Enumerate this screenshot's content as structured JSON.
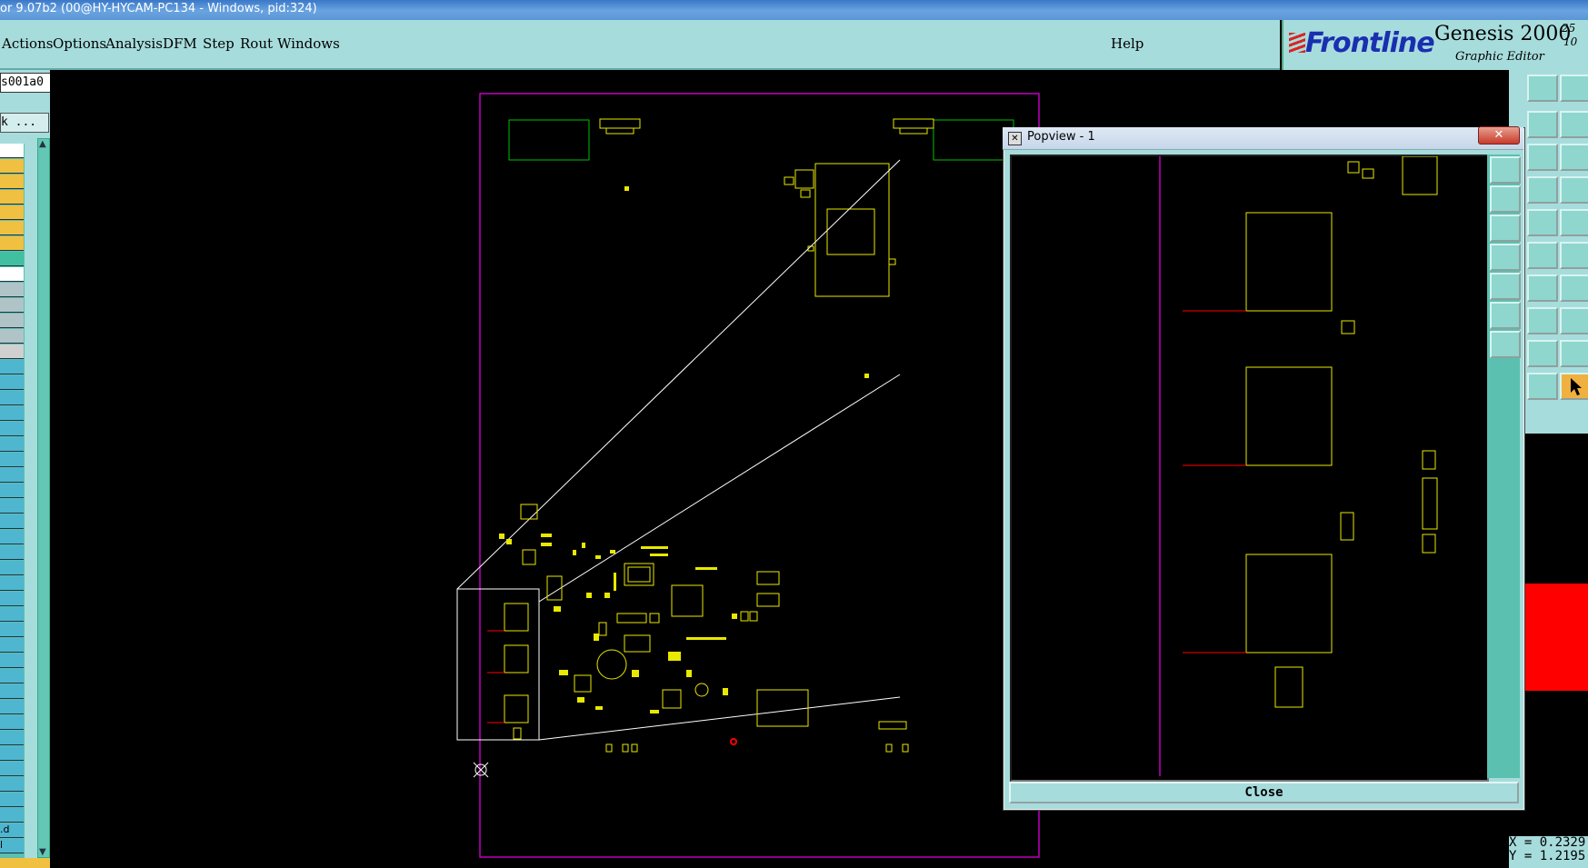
{
  "window_title": "or 9.07b2 (00@HY-HYCAM-PC134 - Windows, pid:324)",
  "menu": {
    "items": [
      "Actions",
      "Options",
      "Analysis",
      "DFM",
      "Step",
      "Rout",
      "Windows"
    ],
    "help": "Help"
  },
  "logo": {
    "brand": "Frontline",
    "product": "Genesis 2000",
    "version_top": "25",
    "version_bottom": "10",
    "subtitle": "Graphic Editor"
  },
  "left_panel": {
    "job_name": "s001a0",
    "filter_label": "k ...",
    "layer_row_labels": [
      "",
      "",
      "",
      "",
      "",
      "",
      "",
      "",
      "",
      "",
      "",
      "",
      "",
      "",
      "",
      "",
      "",
      "",
      "",
      "",
      "",
      "",
      "",
      "",
      "",
      "",
      "",
      "",
      "",
      "",
      "",
      "",
      "",
      "",
      "",
      "",
      "",
      "",
      "",
      "",
      "",
      "",
      "",
      "",
      ".d",
      "l"
    ]
  },
  "popview": {
    "title": "Popview - 1",
    "close_label": "Close"
  },
  "status": {
    "x_readout": "X = 0.2329",
    "y_readout": "Y = 1.2195"
  },
  "colors": {
    "menu_bg": "#a7dcdc",
    "canvas_bg": "#000000",
    "profile_outline": "#c000c0",
    "feature_yellow": "#e8e800",
    "feature_green": "#00c000",
    "highlight_red": "#ff0000"
  }
}
